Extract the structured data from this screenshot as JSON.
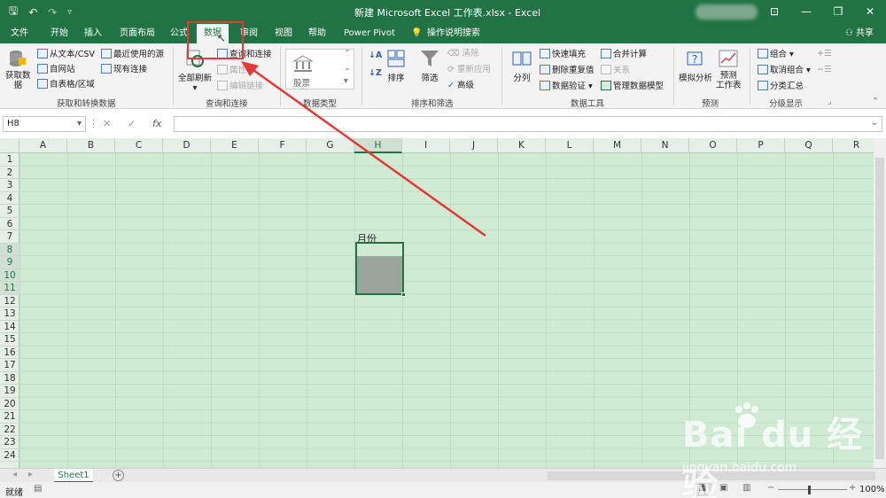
{
  "window": {
    "title": "新建 Microsoft Excel 工作表.xlsx  -  Excel",
    "share_label": "共享"
  },
  "tabs": [
    "文件",
    "开始",
    "插入",
    "页面布局",
    "公式",
    "数据",
    "审阅",
    "视图",
    "帮助",
    "Power Pivot",
    "操作说明搜索"
  ],
  "active_tab": "数据",
  "ribbon": {
    "get_data": "获取数\n据",
    "from_csv": "从文本/CSV",
    "from_web": "自网站",
    "from_table": "自表格/区域",
    "recent_sources": "最近使用的源",
    "existing_connections": "现有连接",
    "group_get_transform": "获取和转换数据",
    "refresh_all": "全部刷新",
    "queries_connections": "查询和连接",
    "properties": "属性",
    "edit_links": "编辑链接",
    "group_queries": "查询和连接",
    "stocks": "股票",
    "group_data_types": "数据类型",
    "sort": "排序",
    "filter": "筛选",
    "clear": "清除",
    "reapply": "重新应用",
    "advanced": "高级",
    "group_sort_filter": "排序和筛选",
    "text_to_columns": "分列",
    "flash_fill": "快速填充",
    "remove_duplicates": "删除重复值",
    "data_validation": "数据验证",
    "consolidate": "合并计算",
    "relationships": "关系",
    "manage_data_model": "管理数据模型",
    "group_data_tools": "数据工具",
    "what_if": "模拟分析",
    "forecast_sheet": "预测\n工作表",
    "group_forecast": "预测",
    "group": "组合",
    "ungroup": "取消组合",
    "subtotal": "分类汇总",
    "group_outline": "分级显示"
  },
  "formula_bar": {
    "name_box": "H8",
    "fx": "fx",
    "cancel": "✕",
    "enter": "✓",
    "content": ""
  },
  "columns": [
    "A",
    "B",
    "C",
    "D",
    "E",
    "F",
    "G",
    "H",
    "I",
    "J",
    "K",
    "L",
    "M",
    "N",
    "O",
    "P",
    "Q",
    "R"
  ],
  "rows": [
    "1",
    "2",
    "3",
    "4",
    "5",
    "6",
    "7",
    "8",
    "9",
    "10",
    "11",
    "12",
    "13",
    "14",
    "15",
    "16",
    "17",
    "18",
    "19",
    "20",
    "21",
    "22",
    "23",
    "24"
  ],
  "selected_column": "H",
  "selected_rows": [
    "8",
    "9",
    "10",
    "11"
  ],
  "cell_h7": "月份",
  "sheets": [
    "Sheet1"
  ],
  "status": {
    "mode": "就绪",
    "zoom": "100%"
  },
  "watermark": {
    "brand": "Bai du 经验",
    "url": "jingyan.baidu.com"
  },
  "colors": {
    "excel_green": "#217346",
    "grid_bg": "#d0ebd4",
    "annotation_red": "#e53935"
  }
}
